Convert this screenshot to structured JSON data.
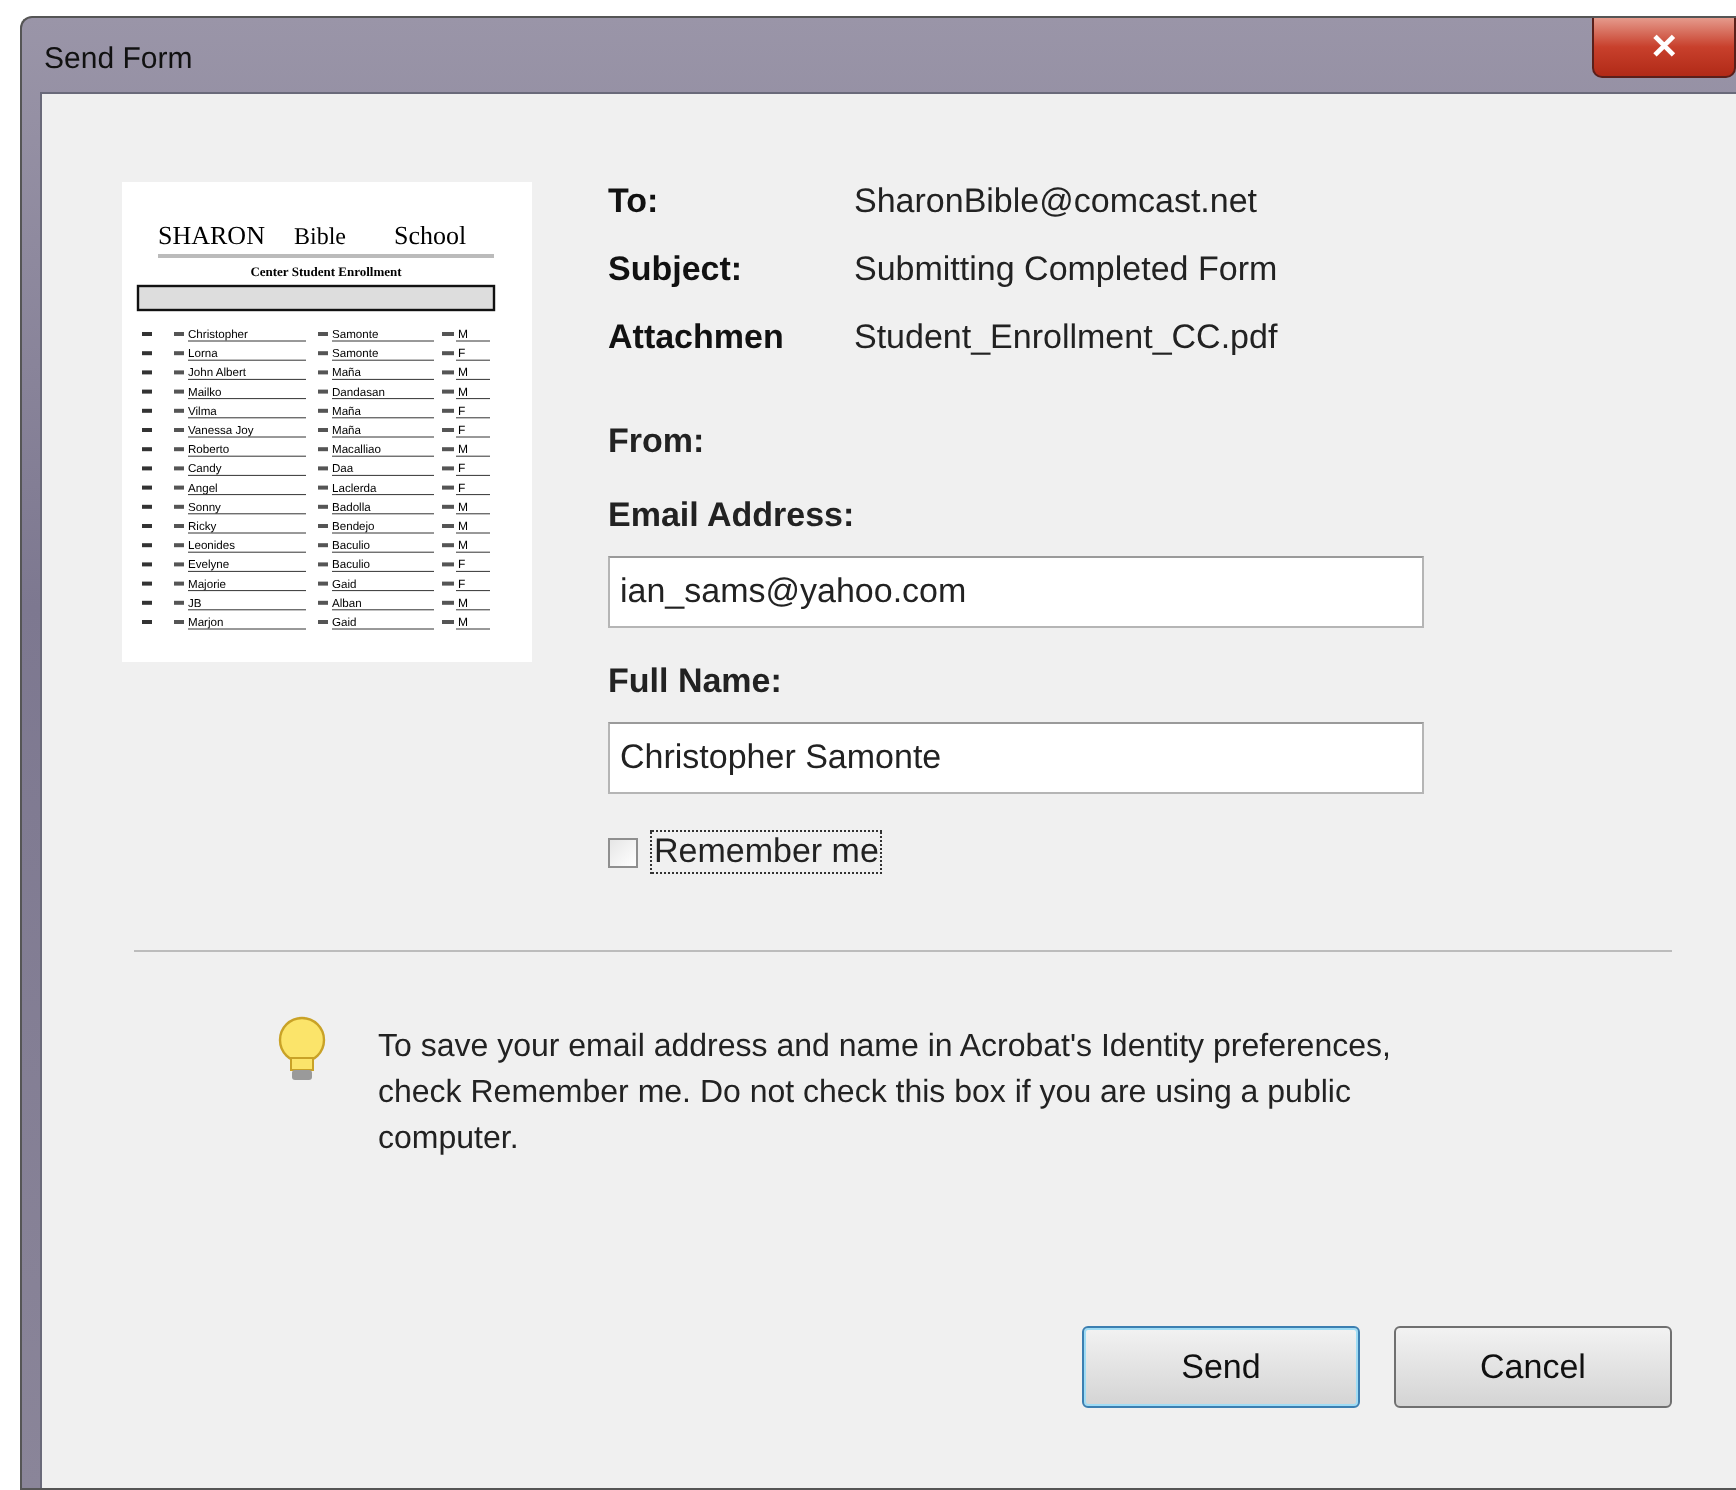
{
  "window": {
    "title": "Send Form",
    "close": "✕"
  },
  "preview": {
    "school_left": "SHARON",
    "school_mid": "Bible",
    "school_right": "School",
    "heading": "Center Student Enrollment",
    "rows": [
      {
        "first": "Christopher",
        "last": "Samonte",
        "gender": "M"
      },
      {
        "first": "Lorna",
        "last": "Samonte",
        "gender": "F"
      },
      {
        "first": "John Albert",
        "last": "Maña",
        "gender": "M"
      },
      {
        "first": "Mailko",
        "last": "Dandasan",
        "gender": "M"
      },
      {
        "first": "Vilma",
        "last": "Maña",
        "gender": "F"
      },
      {
        "first": "Vanessa Joy",
        "last": "Maña",
        "gender": "F"
      },
      {
        "first": "Roberto",
        "last": "Macalliao",
        "gender": "M"
      },
      {
        "first": "Candy",
        "last": "Daa",
        "gender": "F"
      },
      {
        "first": "Angel",
        "last": "Laclerda",
        "gender": "F"
      },
      {
        "first": "Sonny",
        "last": "Badolla",
        "gender": "M"
      },
      {
        "first": "Ricky",
        "last": "Bendejo",
        "gender": "M"
      },
      {
        "first": "Leonides",
        "last": "Baculio",
        "gender": "M"
      },
      {
        "first": "Evelyne",
        "last": "Baculio",
        "gender": "F"
      },
      {
        "first": "Majorie",
        "last": "Gaid",
        "gender": "F"
      },
      {
        "first": "JB",
        "last": "Alban",
        "gender": "M"
      },
      {
        "first": "Marjon",
        "last": "Gaid",
        "gender": "M"
      }
    ]
  },
  "message": [
    {
      "label": "To:",
      "value": "SharonBible@comcast.net"
    },
    {
      "label": "Subject:",
      "value": "Submitting Completed Form"
    },
    {
      "label": "Attachmen",
      "value": "Student_Enrollment_CC.pdf"
    }
  ],
  "from_label": "From:",
  "fields": [
    {
      "label": "Email Address:",
      "value": "ian_sams@yahoo.com"
    },
    {
      "label": "Full Name:",
      "value": "Christopher Samonte"
    }
  ],
  "remember": {
    "label": "Remember me",
    "checked": false
  },
  "tip": "To save your email address and name in Acrobat's Identity preferences, check Remember me. Do not check this box if you are using a public computer.",
  "buttons": [
    {
      "label": "Send",
      "default": true
    },
    {
      "label": "Cancel",
      "default": false
    }
  ]
}
